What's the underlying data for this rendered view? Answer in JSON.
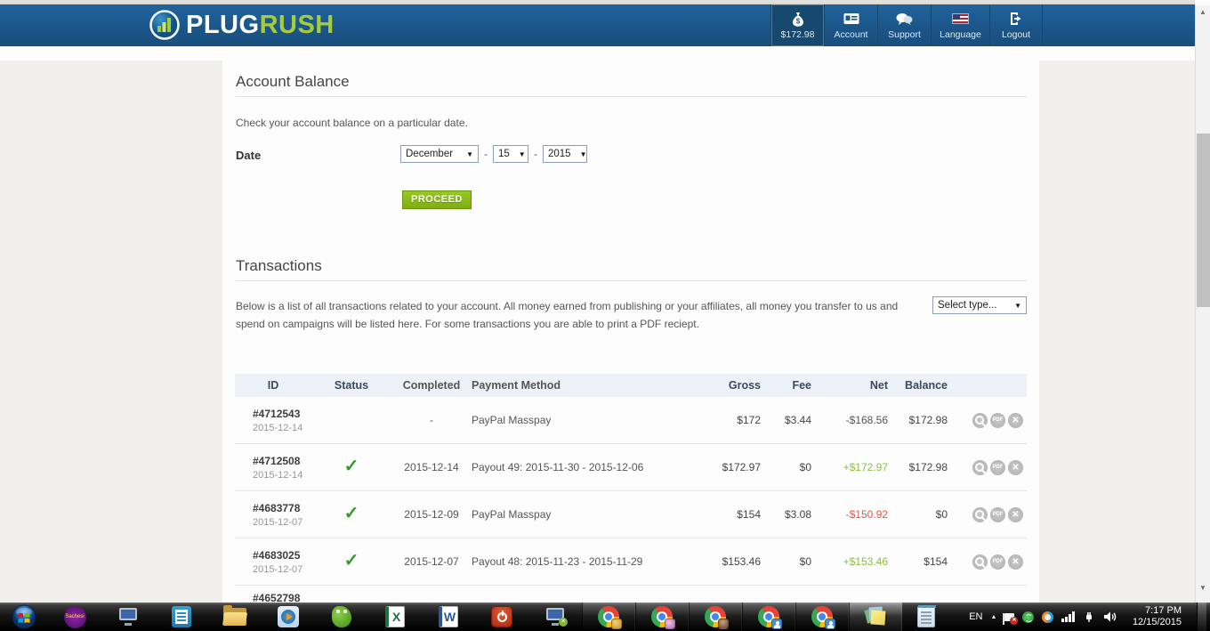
{
  "navbar": {
    "logo_plug": "PLUG",
    "logo_rush": "RUSH",
    "items": [
      {
        "label": "$172.98"
      },
      {
        "label": "Account"
      },
      {
        "label": "Support"
      },
      {
        "label": "Language"
      },
      {
        "label": "Logout"
      }
    ]
  },
  "account_balance": {
    "title": "Account Balance",
    "description": "Check your account balance on a particular date.",
    "date_label": "Date",
    "month": "December",
    "day": "15",
    "year": "2015",
    "separator": "-",
    "dropdown_arrow": "▼",
    "proceed": "PROCEED"
  },
  "transactions": {
    "title": "Transactions",
    "description": "Below is a list of all transactions related to your account. All money earned from publishing or your affiliates, all money you transfer to us and spend on campaigns will be listed here. For some transactions you are able to print a PDF reciept.",
    "type_filter": "Select type...",
    "headers": [
      "ID",
      "Status",
      "Completed",
      "Payment Method",
      "Gross",
      "Fee",
      "Net",
      "Balance"
    ],
    "pdf_label": "PDF",
    "close_glyph": "✕",
    "rows": [
      {
        "id": "#4712543",
        "date": "2015-12-14",
        "status": "",
        "completed": "-",
        "method": "PayPal Masspay",
        "gross": "$172",
        "fee": "$3.44",
        "net": "-$168.56",
        "balance": "$172.98"
      },
      {
        "id": "#4712508",
        "date": "2015-12-14",
        "status": "✓",
        "completed": "2015-12-14",
        "method": "Payout 49: 2015-11-30 - 2015-12-06",
        "gross": "$172.97",
        "fee": "$0",
        "net": "+$172.97",
        "balance": "$172.98"
      },
      {
        "id": "#4683778",
        "date": "2015-12-07",
        "status": "✓",
        "completed": "2015-12-09",
        "method": "PayPal Masspay",
        "gross": "$154",
        "fee": "$3.08",
        "net": "-$150.92",
        "balance": "$0"
      },
      {
        "id": "#4683025",
        "date": "2015-12-07",
        "status": "✓",
        "completed": "2015-12-07",
        "method": "Payout 48: 2015-11-23 - 2015-11-29",
        "gross": "$153.46",
        "fee": "$0",
        "net": "+$153.46",
        "balance": "$154"
      }
    ],
    "partial_row_id": "#4652798"
  },
  "taskbar": {
    "sachesi_label": "Sachesi",
    "excel_letter": "X",
    "word_letter": "W",
    "tray_language": "EN",
    "tray_arrow": "▲",
    "flag_badge": "✕",
    "clock_time": "7:17 PM",
    "clock_date": "12/15/2015"
  },
  "scrollbar": {
    "up_arrow": "▲",
    "down_arrow": "▼"
  },
  "colors": {
    "navbar_blue": "#1d5a8c",
    "brand_green": "#a6cc39",
    "proceed_green": "#85b51e",
    "net_positive": "#8cbf42",
    "net_negative": "#de5948",
    "check_green": "#2f9e23",
    "header_row_bg": "#edf2f8"
  }
}
